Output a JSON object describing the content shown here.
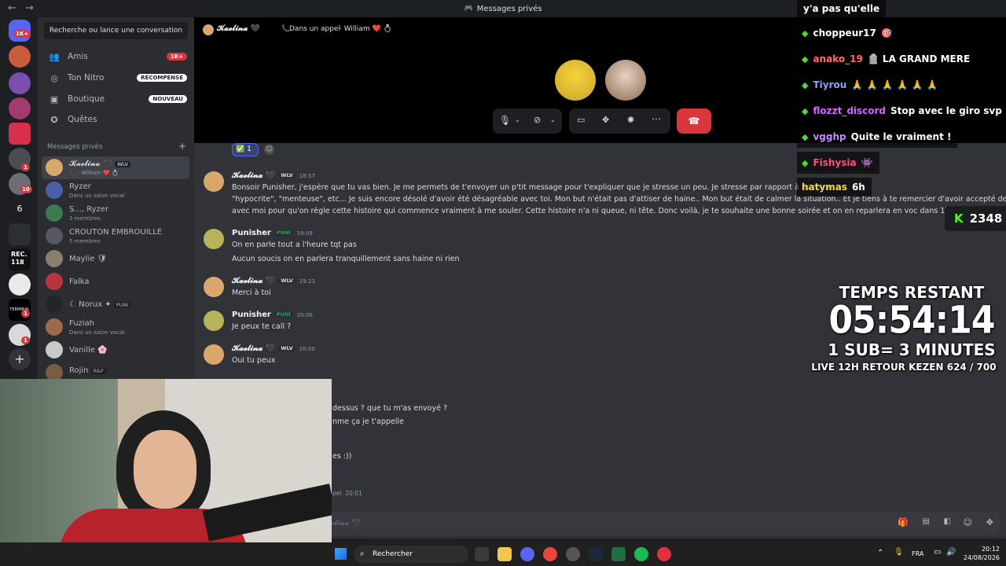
{
  "titlebar": {
    "title": "Messages privés"
  },
  "rail": {
    "home_badge": "1K+",
    "badges": [
      "1",
      "10",
      "1",
      "1",
      "1"
    ],
    "server_label": "6"
  },
  "dm_panel": {
    "search": "Recherche ou lance une conversation",
    "nav": [
      {
        "label": "Amis",
        "pill": "1K+"
      },
      {
        "label": "Ton Nitro",
        "pill": "RÉCOMPENSE"
      },
      {
        "label": "Boutique",
        "pill": "NOUVEAU"
      },
      {
        "label": "Quêtes",
        "pill": ""
      }
    ],
    "section_title": "Messages privés",
    "add_dm": "+",
    "dms": [
      {
        "name": "𝓚𝓪𝓮𝓵𝓲𝓷𝓪 🖤",
        "tag": "WLV",
        "sub": "📞 · William ❤️ 💍"
      },
      {
        "name": "Ryzer",
        "sub": "Dans un salon vocal"
      },
      {
        "name": "S..., Ryzer",
        "sub": "3 membres"
      },
      {
        "name": "CROUTON EMBROUILLE",
        "sub": "5 membres"
      },
      {
        "name": "Maylie 🛡",
        "sub": ""
      },
      {
        "name": "Falka",
        "sub": ""
      },
      {
        "name": "☾ Norux ✦",
        "tag": "PUNI",
        "sub": ""
      },
      {
        "name": "Fuziah",
        "sub": "Dans un salon vocal"
      },
      {
        "name": "Vanille 🌸",
        "sub": ""
      },
      {
        "name": "Rojin",
        "tag": "R&F",
        "sub": ""
      }
    ]
  },
  "call_header": {
    "name": "𝓚𝓪𝓮𝓵𝓲𝓷𝓪 🖤",
    "status": "Dans un appel",
    "with": "· William ❤️ 💍"
  },
  "reaction": {
    "emoji": "✅",
    "count": "1"
  },
  "messages": [
    {
      "author": "𝓚𝓪𝓮𝓵𝓲𝓷𝓪 🖤",
      "tag": "WLV",
      "time": "18:57",
      "lines": [
        "Bonsoir Punisher, j'espère que tu vas bien. Je me permets de t'envoyer un p'tit message pour t'expliquer que je stresse un peu. Je stresse par rapport à ta comm",
        "\"hypocrite\", \"menteuse\", etc... Je suis encore désolé d'avoir été désagréable avec toi. Mon but n'était pas d'attiser de haine.. Mon but était de calmer la situation.. Et je tiens à te remercier d'avoir accepté de parler",
        "avec moi pour qu'on règle cette histoire qui commence vraiment à me souler. Cette histoire n'a ni queue, ni tête. Donc voilà, je te souhaite une bonne soirée et on en reparlera en voc dans 1h :))"
      ]
    },
    {
      "author": "Punisher",
      "tag": "PUNI",
      "time": "19:09",
      "lines": [
        "On en parle tout a l'heure tqt pas",
        "Aucun soucis on en parlera tranquillement sans haine ni rien"
      ]
    },
    {
      "author": "𝓚𝓪𝓮𝓵𝓲𝓷𝓪 🖤",
      "tag": "WLV",
      "time": "19:23",
      "lines": [
        "Merci à toi"
      ]
    },
    {
      "author": "Punisher",
      "tag": "PUNI",
      "time": "20:00",
      "lines": [
        "Je peux te call ?"
      ]
    },
    {
      "author": "𝓚𝓪𝓮𝓵𝓲𝓷𝓪 🖤",
      "tag": "WLV",
      "time": "20:00",
      "lines": [
        "Oui tu peux"
      ]
    }
  ],
  "partial_lines": [
    "dessus ? que tu m'as envoyé ?",
    "nme ça je t'appelle",
    "es :))",
    "pel. 20:01"
  ],
  "input_placeholder": "𝓮𝓵𝓲𝓷𝓪 🖤",
  "overlay_chat": [
    {
      "user": "y'a pas qu'elle",
      "text": "",
      "color": "#ffffff"
    },
    {
      "user": "choppeur17",
      "text": "🎯",
      "color": "#ffffff"
    },
    {
      "user": "anako_19",
      "text": "🪦  LA GRAND MERE",
      "color": "#ff6f61"
    },
    {
      "user": "Tiyrou",
      "text": "🙏 🙏 🙏 🙏 🙏 🙏",
      "color": "#8aa2ff"
    },
    {
      "user": "flozzt_discord",
      "text": "Stop avec le giro svp",
      "color": "#d266ff"
    },
    {
      "user": "vgghp",
      "text": "Quite le vraiment !",
      "color": "#c58aff"
    },
    {
      "user": "Fishysia",
      "text": "👾",
      "color": "#ff4f7b"
    },
    {
      "user": "hatymas",
      "text": "6h",
      "color": "#f2d64b"
    }
  ],
  "kick_count": "2348",
  "timer": {
    "label": "TEMPS RESTANT",
    "time": "05:54:14",
    "rule": "1 SUB= 3 MINUTES",
    "goal": "LIVE 12H RETOUR KEZEN 624 / 700"
  },
  "taskbar": {
    "search": "Rechercher",
    "lang": "FRA",
    "clock": "20:12",
    "date": "24/08/2026"
  },
  "colors": {
    "accent": "#5865f2",
    "danger": "#da373c",
    "kick_green": "#53fc18"
  }
}
